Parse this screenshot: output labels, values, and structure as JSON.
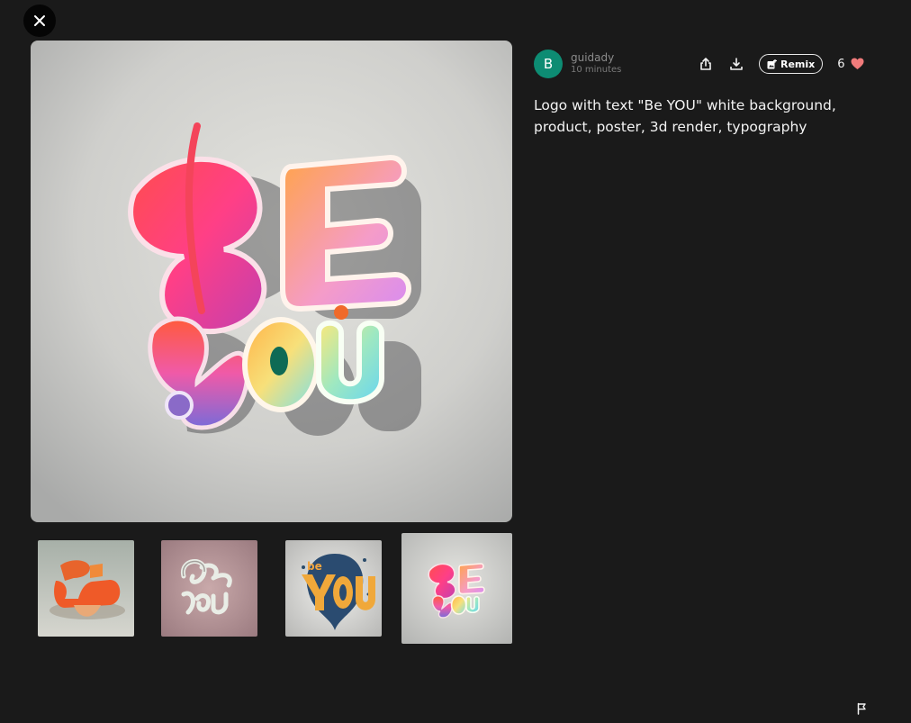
{
  "icons": {
    "close": "close-icon",
    "share": "share-icon",
    "download": "download-icon",
    "remix": "remix-icon",
    "like": "heart-icon",
    "report": "flag-icon"
  },
  "colors": {
    "background": "#1a1a1a",
    "avatar": "#0d8c73",
    "heart": "#f07b7b"
  },
  "author": {
    "initial": "B",
    "name": "guidady",
    "time": "10 minutes"
  },
  "actions": {
    "remix_label": "Remix",
    "like_count": "6"
  },
  "prompt": "Logo with text \"Be YOU\" white background, product, poster, 3d render, typography",
  "gallery": {
    "selected_index": 3,
    "thumbnails": 4
  }
}
